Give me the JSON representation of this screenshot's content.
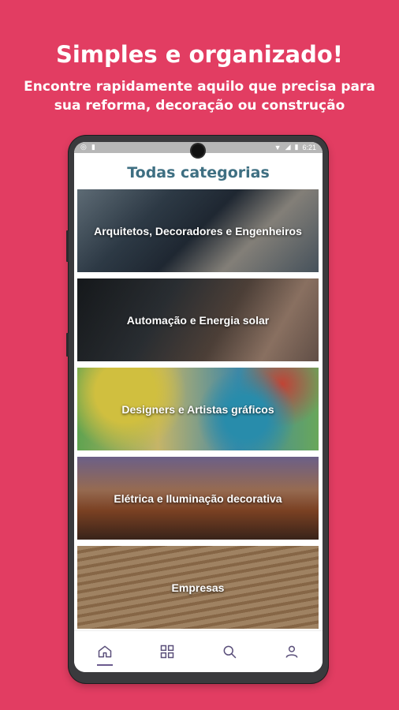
{
  "promo": {
    "headline": "Simples e organizado!",
    "subline": "Encontre rapidamente aquilo que precisa para sua reforma, decoração ou construção"
  },
  "status_bar": {
    "time": "6:21"
  },
  "screen": {
    "title": "Todas categorias",
    "categories": [
      {
        "label": "Arquitetos, Decoradores e Engenheiros"
      },
      {
        "label": "Automação e Energia solar"
      },
      {
        "label": "Designers e Artistas gráficos"
      },
      {
        "label": "Elétrica e Iluminação decorativa"
      },
      {
        "label": "Empresas"
      }
    ]
  },
  "tab_bar": {
    "tabs": [
      {
        "icon": "home-icon",
        "active": true
      },
      {
        "icon": "grid-icon",
        "active": false
      },
      {
        "icon": "search-icon",
        "active": false
      },
      {
        "icon": "user-icon",
        "active": false
      }
    ],
    "active_color": "#6b5a8e",
    "icon_color": "#5a4f7a"
  },
  "colors": {
    "background": "#e23d62",
    "title": "#3e6f82"
  }
}
